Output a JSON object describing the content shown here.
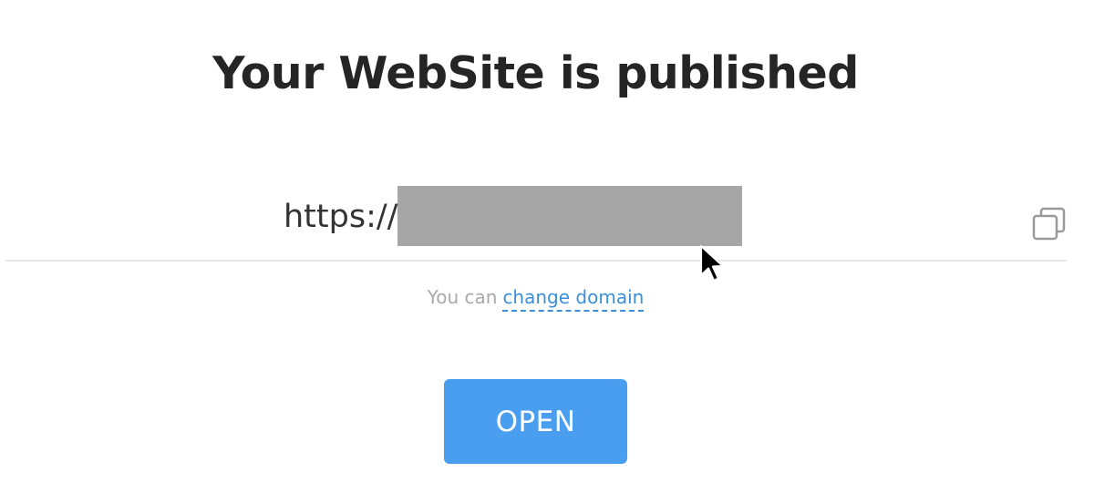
{
  "title": "Your WebSite is published",
  "url": {
    "prefix": "https://"
  },
  "domain_hint": {
    "prefix": "You can",
    "link_label": "change domain"
  },
  "open_button_label": "OPEN",
  "colors": {
    "title": "#252525",
    "redaction": "#a6a6a6",
    "link": "#3a8fd9",
    "button": "#4a9ef0",
    "hint": "#a9a9a9"
  },
  "icons": {
    "copy": "copy-icon",
    "cursor": "mouse-cursor-icon"
  }
}
